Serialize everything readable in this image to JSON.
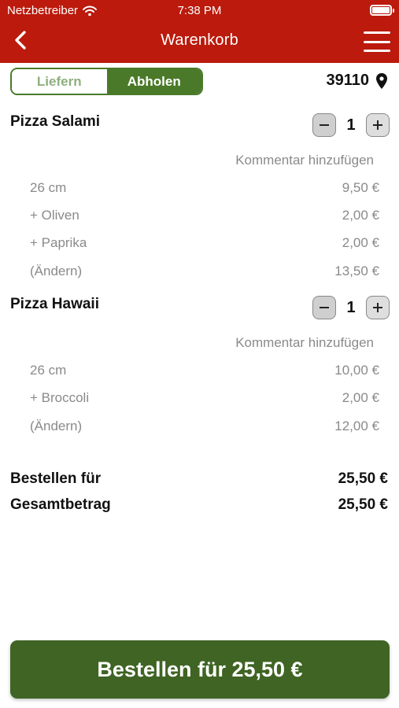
{
  "status_bar": {
    "carrier": "Netzbetreiber",
    "time": "7:38 PM"
  },
  "nav": {
    "title": "Warenkorb"
  },
  "delivery_toggle": {
    "options": [
      "Liefern",
      "Abholen"
    ],
    "selected": "Abholen"
  },
  "location": {
    "zip": "39110"
  },
  "cart_items": [
    {
      "name": "Pizza Salami",
      "quantity": "1",
      "comment_label": "Kommentar hinzufügen",
      "lines": [
        {
          "label": "26 cm",
          "price": "9,50 €"
        },
        {
          "label": "+ Oliven",
          "price": "2,00 €"
        },
        {
          "label": "+ Paprika",
          "price": "2,00 €"
        },
        {
          "label": "(Ändern)",
          "price": "13,50 €"
        }
      ]
    },
    {
      "name": "Pizza Hawaii",
      "quantity": "1",
      "comment_label": "Kommentar hinzufügen",
      "lines": [
        {
          "label": "26 cm",
          "price": "10,00 €"
        },
        {
          "label": "+ Broccoli",
          "price": "2,00 €"
        },
        {
          "label": "(Ändern)",
          "price": "12,00 €"
        }
      ]
    }
  ],
  "totals": [
    {
      "label": "Bestellen für",
      "value": "25,50 €"
    },
    {
      "label": "Gesamtbetrag",
      "value": "25,50 €"
    }
  ],
  "order_button": {
    "label": "Bestellen für 25,50 €"
  },
  "colors": {
    "header": "#bb1a0c",
    "accent_green": "#4a7a29",
    "button_green": "#3f6423",
    "muted_text": "#8a8a8a"
  }
}
